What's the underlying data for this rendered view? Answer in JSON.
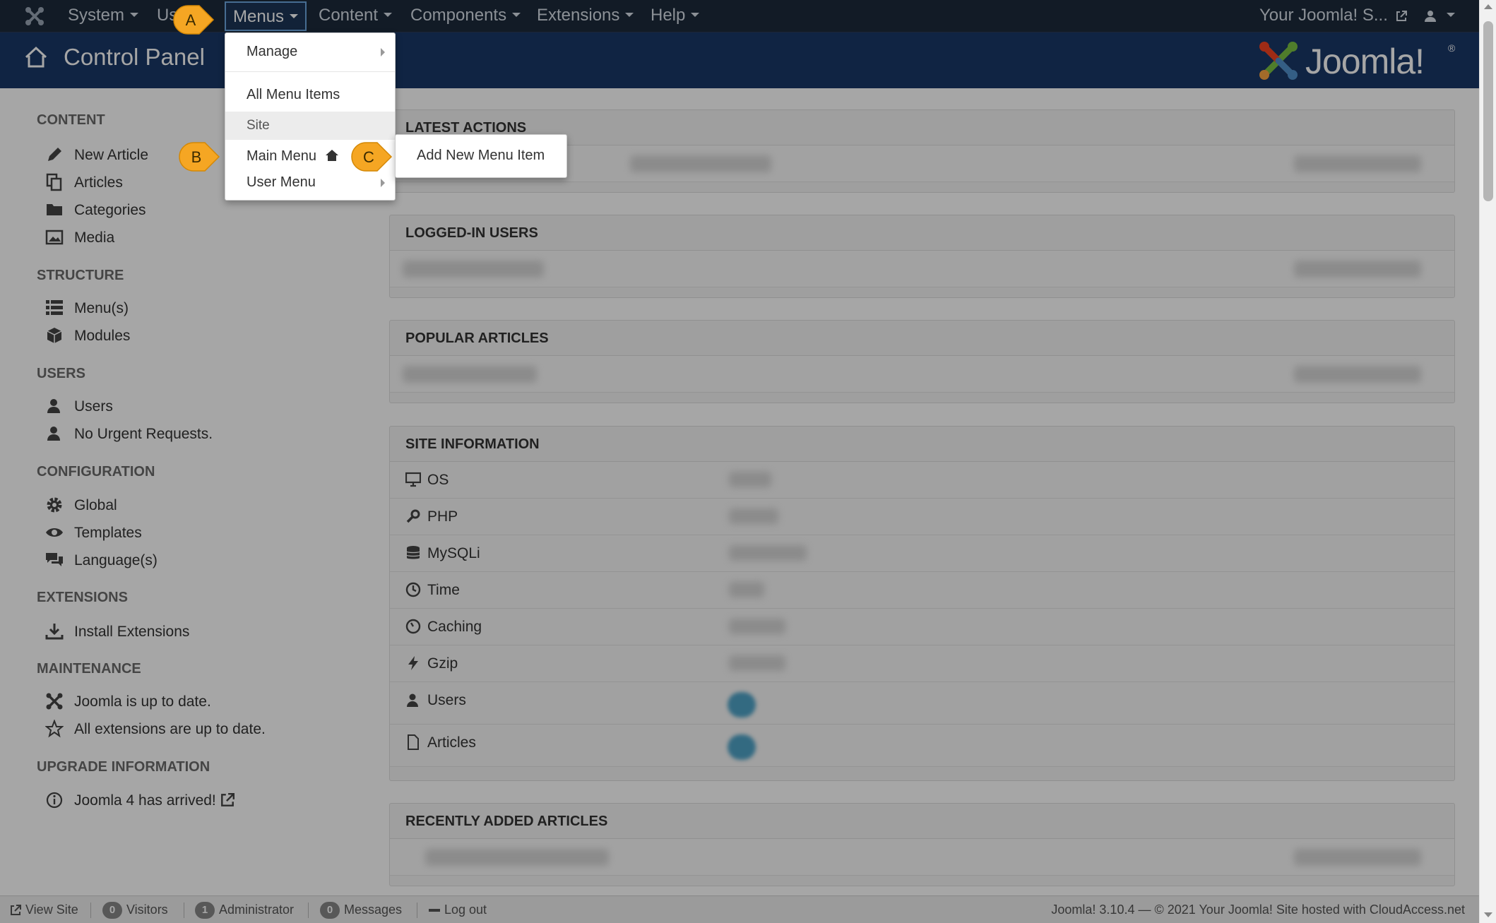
{
  "topbar": {
    "nav": [
      "System",
      "Us",
      "Menus",
      "Content",
      "Components",
      "Extensions",
      "Help"
    ],
    "site_link": "Your Joomla! S...",
    "icons": {
      "brand": "joomla-logo-icon",
      "user": "user-icon",
      "external": "external-link-icon"
    }
  },
  "header": {
    "title": "Control Panel",
    "logo_text": "Joomla!",
    "reg_mark": "®"
  },
  "sidebar": {
    "sections": [
      {
        "heading": "CONTENT",
        "items": [
          {
            "label": "New Article",
            "icon": "pencil-icon"
          },
          {
            "label": "Articles",
            "icon": "copy-icon"
          },
          {
            "label": "Categories",
            "icon": "folder-icon"
          },
          {
            "label": "Media",
            "icon": "image-icon"
          }
        ]
      },
      {
        "heading": "STRUCTURE",
        "items": [
          {
            "label": "Menu(s)",
            "icon": "list-icon"
          },
          {
            "label": "Modules",
            "icon": "cube-icon"
          }
        ]
      },
      {
        "heading": "USERS",
        "items": [
          {
            "label": "Users",
            "icon": "user-icon"
          },
          {
            "label": "No Urgent Requests.",
            "icon": "user-icon"
          }
        ]
      },
      {
        "heading": "CONFIGURATION",
        "items": [
          {
            "label": "Global",
            "icon": "cog-icon"
          },
          {
            "label": "Templates",
            "icon": "eye-icon"
          },
          {
            "label": "Language(s)",
            "icon": "comments-icon"
          }
        ]
      },
      {
        "heading": "EXTENSIONS",
        "items": [
          {
            "label": "Install Extensions",
            "icon": "download-icon"
          }
        ]
      },
      {
        "heading": "MAINTENANCE",
        "items": [
          {
            "label": "Joomla is up to date.",
            "icon": "joomla-icon"
          },
          {
            "label": "All extensions are up to date.",
            "icon": "star-icon"
          }
        ]
      },
      {
        "heading": "UPGRADE INFORMATION",
        "items": [
          {
            "label": "Joomla 4 has arrived!",
            "icon": "info-icon"
          }
        ]
      }
    ]
  },
  "panels": {
    "latest_actions": "LATEST ACTIONS",
    "logged_in_users": "LOGGED-IN USERS",
    "popular_articles": "POPULAR ARTICLES",
    "site_information": "SITE INFORMATION",
    "recently_added": "RECENTLY ADDED ARTICLES"
  },
  "site_info": [
    "OS",
    "PHP",
    "MySQLi",
    "Time",
    "Caching",
    "Gzip",
    "Users",
    "Articles"
  ],
  "dropdown": {
    "manage": "Manage",
    "all_menu_items": "All Menu Items",
    "site": "Site",
    "main_menu": "Main Menu",
    "user_menu": "User Menu"
  },
  "submenu": {
    "add_new": "Add New Menu Item"
  },
  "callouts": {
    "a": "A",
    "b": "B",
    "c": "C"
  },
  "statusbar": {
    "view_site": "View Site",
    "visitors_count": "0",
    "visitors": "Visitors",
    "admin_count": "1",
    "admin": "Administrator",
    "messages_count": "0",
    "messages": "Messages",
    "logout": "Log out",
    "footer": "Joomla! 3.10.4  —  © 2021 Your Joomla! Site hosted with CloudAccess.net"
  },
  "colors": {
    "topbar": "#1c2a3b",
    "header": "#1a3867",
    "callout": "#f5a623",
    "accent": "#6ea8e0"
  }
}
